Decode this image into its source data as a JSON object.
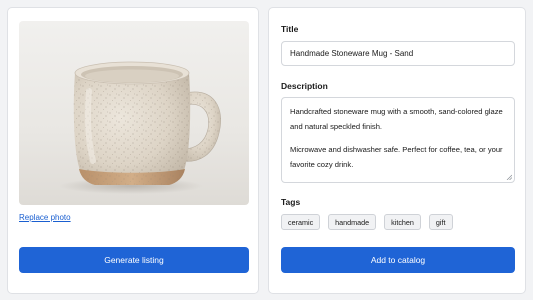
{
  "photo": {
    "alt": "Speckled sand-colored stoneware mug",
    "replace_label": "Replace photo"
  },
  "actions": {
    "generate_label": "Generate listing",
    "add_label": "Add to catalog"
  },
  "form": {
    "title_label": "Title",
    "title_value": "Handmade Stoneware Mug - Sand",
    "description_label": "Description",
    "description_paragraphs": [
      "Handcrafted stoneware mug with a smooth, sand-colored glaze and natural speckled finish.",
      "Microwave and dishwasher safe. Perfect for coffee, tea, or your favorite cozy drink."
    ],
    "tags_label": "Tags",
    "tags": [
      "ceramic",
      "handmade",
      "kitchen",
      "gift"
    ]
  },
  "colors": {
    "primary": "#1f64d6",
    "link": "#1a5fd0",
    "background": "#f2f3f5"
  }
}
